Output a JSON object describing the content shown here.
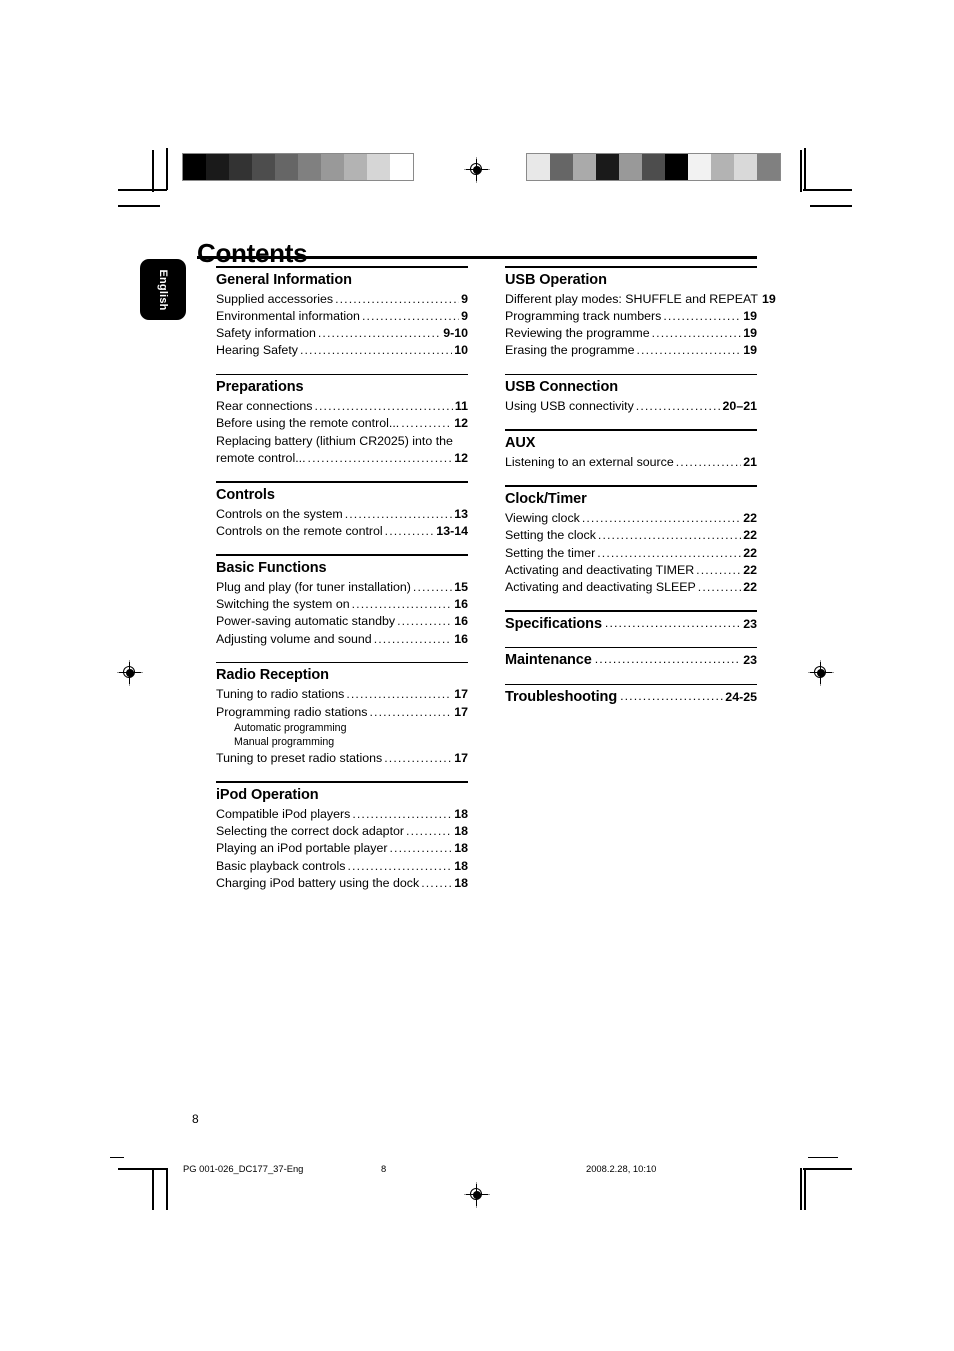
{
  "page": {
    "title": "Contents",
    "language_tab": "English",
    "folio": "8"
  },
  "footer": {
    "file": "PG 001-026_DC177_37-Eng",
    "page": "8",
    "date": "2008.2.28, 10:10"
  },
  "calibration": {
    "left_bar": [
      "#000000",
      "#1a1a1a",
      "#333333",
      "#4d4d4d",
      "#666666",
      "#808080",
      "#999999",
      "#b3b3b3",
      "#d6d6d6",
      "#ffffff"
    ],
    "right_bar": [
      "#e8e8e8",
      "#666666",
      "#aaaaaa",
      "#1a1a1a",
      "#999999",
      "#4d4d4d",
      "#000000",
      "#f2f2f2",
      "#b3b3b3",
      "#d9d9d9",
      "#808080"
    ]
  },
  "columns": {
    "left": [
      {
        "heading": "General Information",
        "entries": [
          {
            "label": "Supplied accessories",
            "page": "9"
          },
          {
            "label": "Environmental information",
            "page": "9"
          },
          {
            "label": "Safety information",
            "page": "9-10"
          },
          {
            "label": "Hearing Safety",
            "page": "10"
          }
        ]
      },
      {
        "heading": "Preparations",
        "entries": [
          {
            "label": "Rear connections",
            "page": "11"
          },
          {
            "label": "Before using the remote control...",
            "page": "12"
          }
        ],
        "wrapped_entry": {
          "line1": "Replacing battery (lithium CR2025) into the",
          "line2": "remote control...",
          "page": "12"
        }
      },
      {
        "heading": "Controls",
        "entries": [
          {
            "label": "Controls on the system",
            "page": "13"
          },
          {
            "label": "Controls on the remote control",
            "page": "13-14"
          }
        ]
      },
      {
        "heading": "Basic Functions",
        "entries": [
          {
            "label": "Plug and play (for tuner installation)",
            "page": "15"
          },
          {
            "label": "Switching the system on",
            "page": "16"
          },
          {
            "label": "Power-saving automatic standby",
            "page": "16"
          },
          {
            "label": "Adjusting volume and sound",
            "page": "16"
          }
        ]
      },
      {
        "heading": "Radio Reception",
        "entries": [
          {
            "label": "Tuning to radio stations",
            "page": "17"
          },
          {
            "label": "Programming radio stations",
            "page": "17"
          }
        ],
        "subentries": [
          "Automatic programming",
          "Manual programming"
        ],
        "entries_after_sub": [
          {
            "label": "Tuning to preset radio stations",
            "page": "17"
          }
        ]
      },
      {
        "heading": "iPod Operation",
        "entries": [
          {
            "label": "Compatible iPod players",
            "page": "18"
          },
          {
            "label": "Selecting the correct dock adaptor",
            "page": "18"
          },
          {
            "label": "Playing an iPod portable player",
            "page": "18"
          },
          {
            "label": "Basic playback controls",
            "page": "18"
          },
          {
            "label": "Charging iPod battery using the dock",
            "page": "18"
          }
        ]
      }
    ],
    "right": [
      {
        "heading": "USB Operation",
        "entries": [
          {
            "label": "Different play modes: SHUFFLE and REPEAT",
            "page": "19",
            "no_dots": true
          },
          {
            "label": "Programming track numbers",
            "page": "19"
          },
          {
            "label": "Reviewing the programme",
            "page": "19"
          },
          {
            "label": "Erasing the programme",
            "page": "19"
          }
        ]
      },
      {
        "heading": "USB Connection",
        "entries": [
          {
            "label": "Using USB connectivity",
            "page": "20–21"
          }
        ]
      },
      {
        "heading": "AUX",
        "entries": [
          {
            "label": "Listening to an external source",
            "page": "21"
          }
        ]
      },
      {
        "heading": "Clock/Timer",
        "entries": [
          {
            "label": "Viewing clock",
            "page": "22"
          },
          {
            "label": "Setting the clock",
            "page": "22"
          },
          {
            "label": "Setting the timer",
            "page": "22"
          },
          {
            "label": "Activating and deactivating TIMER",
            "page": "22"
          },
          {
            "label": "Activating and deactivating SLEEP",
            "page": "22"
          }
        ]
      },
      {
        "heading": "Specifications",
        "heading_page": "23",
        "entries": []
      },
      {
        "heading": "Maintenance",
        "heading_page": "23",
        "entries": []
      },
      {
        "heading": "Troubleshooting",
        "heading_page": "24-25",
        "entries": []
      }
    ]
  }
}
